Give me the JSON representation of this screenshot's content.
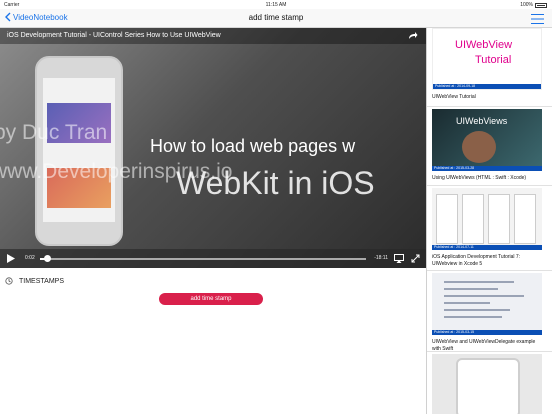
{
  "status_bar": {
    "carrier": "Carrier",
    "time": "11:15 AM",
    "battery": "100%"
  },
  "nav": {
    "back_label": "VideoNotebook",
    "title": "add time stamp"
  },
  "video": {
    "title": "iOS Development Tutorial - UIControl Series How to Use UIWebView",
    "watermark_top": "by Duc Tran",
    "watermark_bottom": "www.Developerinspirus.io",
    "headline_line1": "How to load web pages w",
    "headline_line2": "WebKit in iOS",
    "current_time": "0:02",
    "remaining_time": "-18:11",
    "progress": 0.02
  },
  "timestamps": {
    "header": "TIMESTAMPS",
    "add_button": "add time stamp"
  },
  "sidebar": {
    "items": [
      {
        "thumb_text1": "UIWebView",
        "thumb_text2": "Tutorial",
        "date": "Published at : 2014-09-18",
        "title": "UIWebView Tutorial"
      },
      {
        "thumb_text1": "UIWebViews",
        "date": "Published at : 2015-03-28",
        "title": "Using UIWebViews (HTML : Swift : Xcode)"
      },
      {
        "date": "Published at : 2014-07-11",
        "title": "iOS Application Development Tutorial 7: UIWebview in Xcode 5"
      },
      {
        "date": "Published at : 2015-03-15",
        "title": "UIWebView and UIWebViewDelegate example with Swift"
      },
      {
        "date": "",
        "title": ""
      }
    ]
  },
  "colors": {
    "accent": "#1a73e8",
    "add_button": "#d9204b",
    "date_bar": "#0b4fb5"
  }
}
